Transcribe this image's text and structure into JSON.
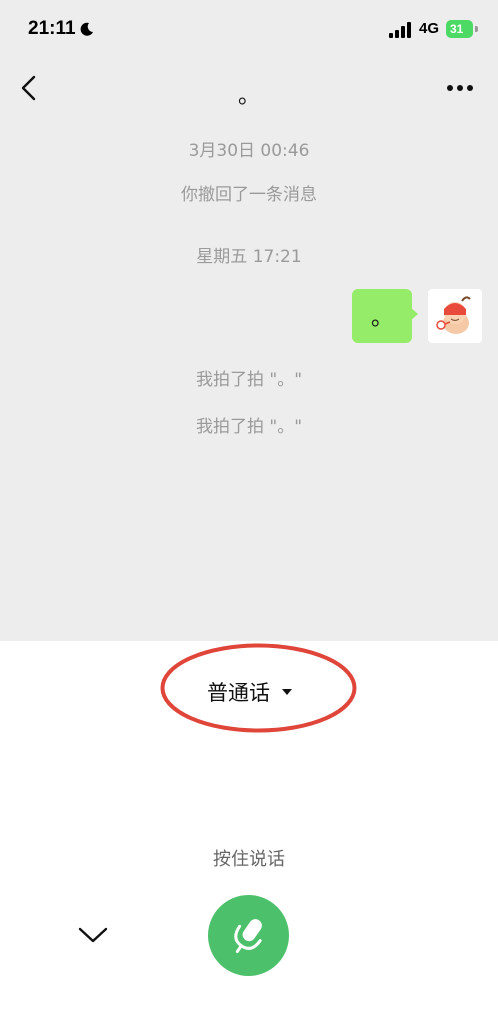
{
  "status_bar": {
    "time": "21:11",
    "network": "4G",
    "battery_level": "31",
    "icons": [
      "moon-icon",
      "signal-icon",
      "battery-icon"
    ]
  },
  "nav": {
    "title": "。",
    "icons": [
      "back-arrow-icon",
      "more-dots-icon"
    ]
  },
  "messages": {
    "timestamp_1": "3月30日 00:46",
    "recall_notice": "你撤回了一条消息",
    "timestamp_2": "星期五 17:21",
    "sent_message": "。",
    "pat_1": "我拍了拍 \"。\"",
    "pat_2": "我拍了拍 \"。\""
  },
  "voice_panel": {
    "language": "普通话",
    "hold_to_talk": "按住说话",
    "icons": [
      "chevron-down-icon",
      "microphone-icon"
    ]
  },
  "colors": {
    "chat_background": "#ededed",
    "sent_bubble": "#95ec69",
    "mic_button": "#4cc06a",
    "annotation": "#e0453a",
    "battery": "#4cd964"
  }
}
